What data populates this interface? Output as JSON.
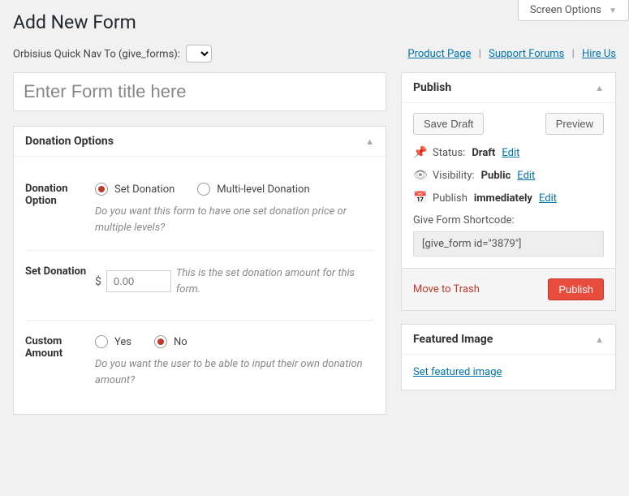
{
  "screen_options": "Screen Options",
  "page_title": "Add New Form",
  "quicknav_label": "Orbisius Quick Nav To (give_forms):",
  "header_links": {
    "product_page": "Product Page",
    "support_forums": "Support Forums",
    "hire_us": "Hire Us"
  },
  "title_placeholder": "Enter Form title here",
  "donation_options": {
    "panel_title": "Donation Options",
    "option_label": "Donation Option",
    "option_set": "Set Donation",
    "option_multi": "Multi-level Donation",
    "option_help": "Do you want this form to have one set donation price or multiple levels?",
    "set_label": "Set Donation",
    "currency": "$",
    "amount_placeholder": "0.00",
    "set_help": "This is the set donation amount for this form.",
    "custom_label": "Custom Amount",
    "custom_yes": "Yes",
    "custom_no": "No",
    "custom_help": "Do you want the user to be able to input their own donation amount?"
  },
  "publish": {
    "panel_title": "Publish",
    "save_draft": "Save Draft",
    "preview": "Preview",
    "status_label": "Status:",
    "status_value": "Draft",
    "visibility_label": "Visibility:",
    "visibility_value": "Public",
    "publish_label": "Publish",
    "publish_value": "immediately",
    "edit": "Edit",
    "shortcode_label": "Give Form Shortcode:",
    "shortcode_value": "[give_form id=\"3879\"]",
    "trash": "Move to Trash",
    "publish_btn": "Publish"
  },
  "featured": {
    "panel_title": "Featured Image",
    "link": "Set featured image"
  }
}
